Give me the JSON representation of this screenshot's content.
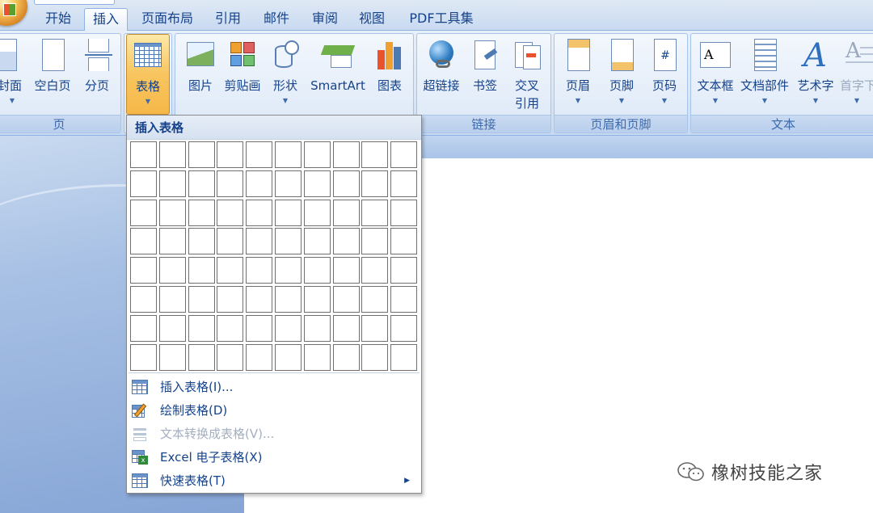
{
  "tabs": [
    "开始",
    "插入",
    "页面布局",
    "引用",
    "邮件",
    "审阅",
    "视图",
    "PDF工具集"
  ],
  "active_tab": "插入",
  "ribbon": {
    "page_group": {
      "label": "页",
      "buttons": [
        "封面",
        "空白页",
        "分页"
      ]
    },
    "table_button": "表格",
    "illustration_buttons": [
      "图片",
      "剪贴画",
      "形状",
      "SmartArt",
      "图表"
    ],
    "link_group": {
      "label": "链接",
      "buttons": [
        "超链接",
        "书签",
        "交叉\n引用"
      ],
      "cross_line1": "交叉",
      "cross_line2": "引用"
    },
    "header_footer_group": {
      "label": "页眉和页脚",
      "buttons": [
        "页眉",
        "页脚",
        "页码"
      ]
    },
    "text_group": {
      "label": "文本",
      "buttons": [
        "文本框",
        "文档部件",
        "艺术字",
        "首字下"
      ]
    }
  },
  "dropdown": {
    "header": "插入表格",
    "grid": {
      "columns": 10,
      "rows": 8
    },
    "items": [
      {
        "label": "插入表格(I)...",
        "icon": "table-icon",
        "enabled": true
      },
      {
        "label": "绘制表格(D)",
        "icon": "pencil-table-icon",
        "enabled": true
      },
      {
        "label": "文本转换成表格(V)...",
        "icon": "convert-text-icon",
        "enabled": false
      },
      {
        "label": "Excel 电子表格(X)",
        "icon": "excel-icon",
        "enabled": true
      },
      {
        "label": "快速表格(T)",
        "icon": "quick-table-icon",
        "enabled": true,
        "has_submenu": true
      }
    ]
  },
  "watermark": "橡树技能之家",
  "colors": {
    "ribbon_text": "#15428b",
    "pressed": "#f8c55f",
    "border": "#8db2e3"
  }
}
